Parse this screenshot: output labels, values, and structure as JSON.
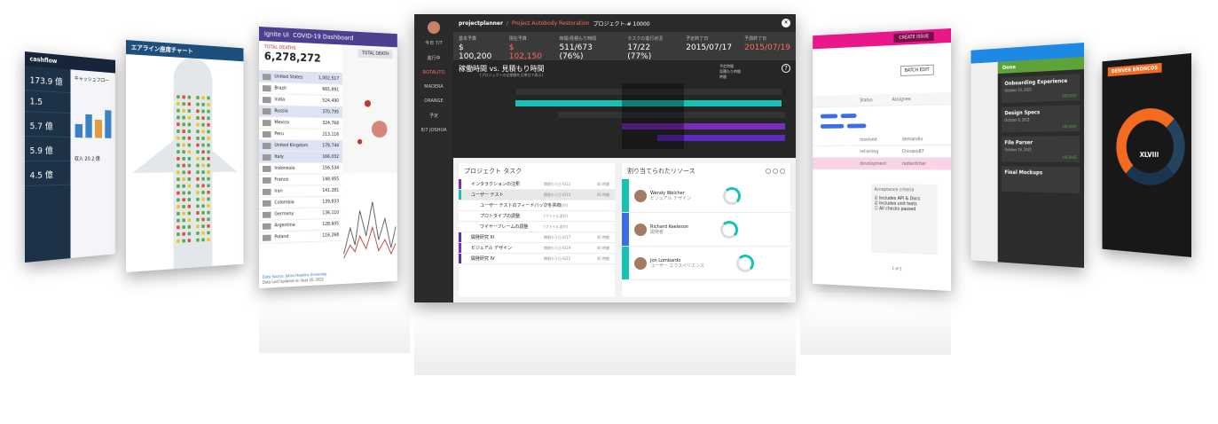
{
  "cashflow": {
    "brand": "cashflow",
    "subtitle": "キャッシュフロー",
    "income_label": "収入 20.2 億",
    "kpis": [
      "173.9 億",
      "1.5",
      "5.7 億",
      "5.9 億",
      "4.5 億"
    ]
  },
  "airline": {
    "title": "エアライン座席チャート"
  },
  "covid": {
    "brand": "Ignite UI",
    "title": "COVID-19 Dashboard",
    "total_label": "TOTAL DEATHS",
    "total": "6,278,272",
    "right_header": "TOTAL DEATH",
    "footer1": "Data Source: Johns Hopkins University",
    "footer2": "Data Last Updated on Sept 16, 2022",
    "countries": [
      {
        "name": "United States",
        "value": "1,002,517",
        "hl": true
      },
      {
        "name": "Brazil",
        "value": "665,891"
      },
      {
        "name": "India",
        "value": "524,490"
      },
      {
        "name": "Russia",
        "value": "370,795",
        "hl": true
      },
      {
        "name": "Mexico",
        "value": "324,768"
      },
      {
        "name": "Peru",
        "value": "213,116"
      },
      {
        "name": "United Kingdom",
        "value": "178,744",
        "hl": true
      },
      {
        "name": "Italy",
        "value": "166,032",
        "hl": true
      },
      {
        "name": "Indonesia",
        "value": "156,534"
      },
      {
        "name": "France",
        "value": "148,955"
      },
      {
        "name": "Iran",
        "value": "141,281"
      },
      {
        "name": "Colombia",
        "value": "139,833"
      },
      {
        "name": "Germany",
        "value": "136,110"
      },
      {
        "name": "Argentina",
        "value": "128,605"
      },
      {
        "name": "Poland",
        "value": "116,268"
      }
    ]
  },
  "planner": {
    "brand": "projectplanner",
    "project": "Project Autobody Restoration",
    "project_code": "プロジェクト-# 10000",
    "nav": [
      "今日 7/7",
      "進行中",
      "ROTALITO",
      "MADERA",
      "ORANGE",
      "予定",
      "8/7 JOSHUA"
    ],
    "stats": [
      {
        "label": "基本予算",
        "value": "$ 100,200"
      },
      {
        "label": "現在予算",
        "value": "$ 102,150",
        "red": true
      },
      {
        "label": "時間/見積もり時間",
        "value": "511/673 (76%)"
      },
      {
        "label": "タスクの進行状況",
        "value": "17/22 (77%)"
      },
      {
        "label": "予定終了日",
        "value": "2015/07/17"
      },
      {
        "label": "予測終了日",
        "value": "2015/07/19",
        "red": true
      }
    ],
    "chart_title": "稼働時間 vs. 見積もり時間",
    "chart_sub": "(プロジェクトの全期間を日単位で表示)",
    "legend": [
      "予定時間",
      "見積もり時間",
      "時間"
    ],
    "tasks_title": "プロジェクト タスク",
    "tasks": [
      {
        "name": "インタラクションの注釈",
        "date": "期限もう日 6/12",
        "hours": "40 時間"
      },
      {
        "name": "ユーザー テスト",
        "date": "期限もう日 6/15",
        "hours": "40 時間"
      },
      {
        "name": "ユーザー テストのフィードバックを共有",
        "date": "(ファイル添付)",
        "sub": true
      },
      {
        "name": "プロトタイプの調整",
        "date": "(ファイル添付)",
        "sub": true
      },
      {
        "name": "ワイヤーフレームの調整",
        "date": "(ファイル添付)",
        "sub": true
      },
      {
        "name": "開発研究 III",
        "date": "期限もう日 6/17",
        "hours": "40 時間"
      },
      {
        "name": "ビジュアル デザイン",
        "date": "期限もう日 6/19",
        "hours": "40 時間"
      },
      {
        "name": "開発研究 IV",
        "date": "期限もう日 6/22",
        "hours": "40 時間"
      }
    ],
    "res_title": "割り当てられたリソース",
    "resources": [
      {
        "name": "Wendy Welcher",
        "role": "ビジュアル デザイン"
      },
      {
        "name": "Richard Keeleson",
        "role": "開発者"
      },
      {
        "name": "Jon Lombardo",
        "role": "ユーザー エクスペリエンス"
      }
    ]
  },
  "issues": {
    "create": "CREATE ISSUE",
    "batch": "BATCH EDIT",
    "columns": [
      "Status",
      "Assignee"
    ],
    "rows": [
      "resolved",
      "ref-erring",
      "development"
    ],
    "assignees": [
      "demandio",
      "Chinaso87",
      "radiantchar"
    ],
    "criteria": "Acceptance criteria",
    "checks": [
      "Includes API & Docs",
      "Includes unit tests",
      "All checks passed"
    ],
    "pager": "1 of 2"
  },
  "kanban": {
    "done": "Done",
    "items": [
      {
        "title": "Onboarding Experience",
        "date": "October 10, 2021",
        "action": "ARCHIVE"
      },
      {
        "title": "Design Specs",
        "date": "October 8, 2021",
        "action": "ARCHIVE"
      },
      {
        "title": "File Parser",
        "date": "October 16, 2021",
        "action": "ARCHIVE"
      },
      {
        "title": "Final Mockups",
        "date": "",
        "action": ""
      }
    ]
  },
  "broncos": {
    "title": "DENVER BRONCOS",
    "center": "XLVIII"
  }
}
